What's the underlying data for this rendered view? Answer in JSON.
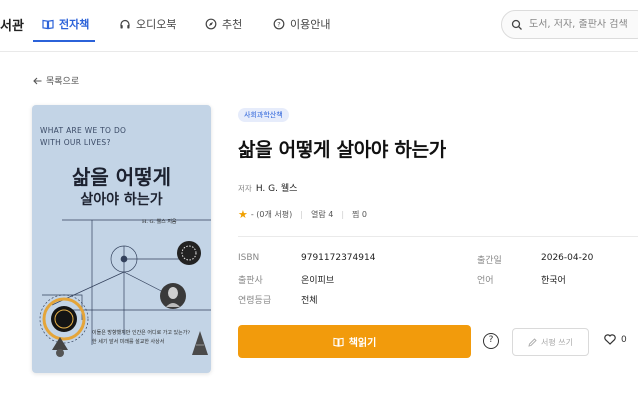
{
  "nav": {
    "brand": "서관",
    "tabs": [
      {
        "label": "전자책",
        "icon": "book-icon",
        "active": true
      },
      {
        "label": "오디오북",
        "icon": "headphones-icon",
        "active": false
      },
      {
        "label": "추천",
        "icon": "compass-icon",
        "active": false
      },
      {
        "label": "이용안내",
        "icon": "help-circle-icon",
        "active": false
      }
    ],
    "search_placeholder": "도서, 저자, 출판사 검색"
  },
  "back_label": "목록으로",
  "cover": {
    "english_subtitle_line1": "WHAT ARE WE TO DO",
    "english_subtitle_line2": "WITH OUR LIVES?",
    "title_line1": "삶을 어떻게",
    "title_line2": "살아야 하는가",
    "author": "H. G. 웰스 지음",
    "quote_line1": "이들은 방향했지만 인간은 어디로 가고 있는가?",
    "quote_line2": "한 세기 앞서 미래를 설교한 사상서"
  },
  "book": {
    "category": "사회과학산책",
    "title": "삶을 어떻게 살아야 하는가",
    "author_label": "저자",
    "author": "H. G. 웰스",
    "rating_text": "- (0개 서평)",
    "views_text": "열람 4",
    "likes_text": "찜 0",
    "meta": [
      {
        "key": "ISBN",
        "value": "9791172374914"
      },
      {
        "key": "출간일",
        "value": "2026-04-20"
      },
      {
        "key": "출판사",
        "value": "온이피브"
      },
      {
        "key": "언어",
        "value": "한국어"
      },
      {
        "key": "연령등급",
        "value": "전체"
      }
    ]
  },
  "actions": {
    "read_label": "책읽기",
    "help_label": "?",
    "review_label": "서평 쓰기",
    "like_count": "0"
  },
  "colors": {
    "accent": "#2b62d9",
    "read_button": "#f29b0c",
    "cover_bg": "#c3d4e6"
  }
}
